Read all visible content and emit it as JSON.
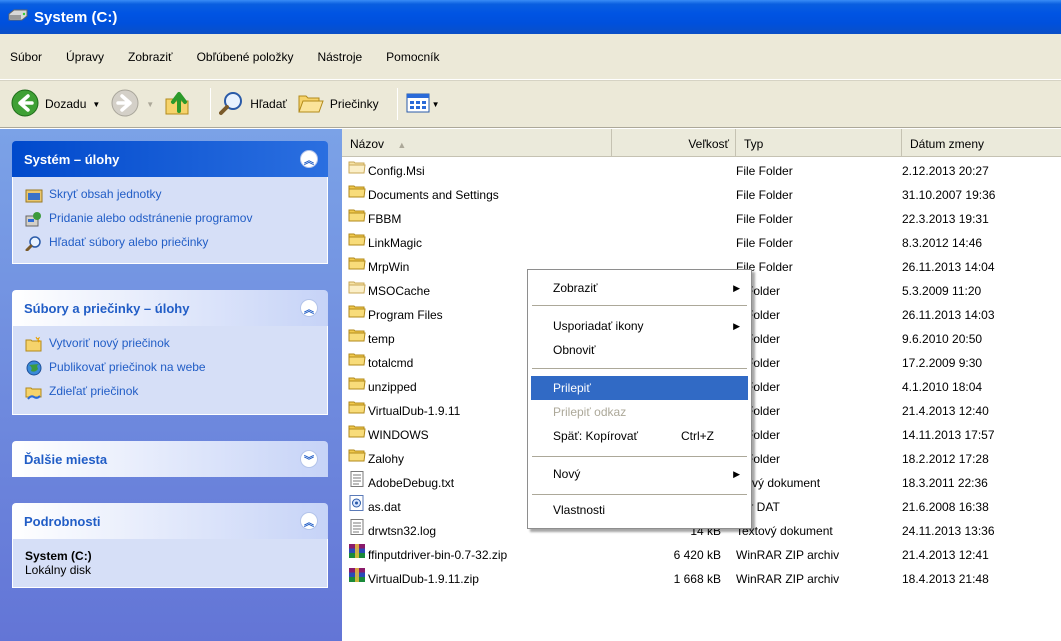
{
  "window": {
    "title": "System (C:)"
  },
  "menubar": [
    "Súbor",
    "Úpravy",
    "Zobraziť",
    "Obľúbené položky",
    "Nástroje",
    "Pomocník"
  ],
  "toolbar": {
    "back": "Dozadu",
    "search": "Hľadať",
    "folders": "Priečinky"
  },
  "tasks": {
    "system": {
      "title": "Systém – úlohy",
      "items": [
        "Skryť obsah jednotky",
        "Pridanie alebo odstránenie programov",
        "Hľadať súbory alebo priečinky"
      ]
    },
    "files": {
      "title": "Súbory a priečinky – úlohy",
      "items": [
        "Vytvoriť nový priečinok",
        "Publikovať priečinok na webe",
        "Zdieľať priečinok"
      ]
    },
    "other": {
      "title": "Ďalšie miesta"
    },
    "details": {
      "title": "Podrobnosti",
      "name": "System (C:)",
      "type": "Lokálny disk"
    }
  },
  "columns": {
    "name": "Názov",
    "size": "Veľkosť",
    "type": "Typ",
    "date": "Dátum zmeny"
  },
  "files": [
    {
      "name": "Config.Msi",
      "size": "",
      "type": "File Folder",
      "date": "2.12.2013 20:27",
      "icon": "folder-light"
    },
    {
      "name": "Documents and Settings",
      "size": "",
      "type": "File Folder",
      "date": "31.10.2007 19:36",
      "icon": "folder"
    },
    {
      "name": "FBBM",
      "size": "",
      "type": "File Folder",
      "date": "22.3.2013 19:31",
      "icon": "folder"
    },
    {
      "name": "LinkMagic",
      "size": "",
      "type": "File Folder",
      "date": "8.3.2012 14:46",
      "icon": "folder"
    },
    {
      "name": "MrpWin",
      "size": "",
      "type": "File Folder",
      "date": "26.11.2013 14:04",
      "icon": "folder"
    },
    {
      "name": "MSOCache",
      "size": "",
      "type": "e Folder",
      "date": "5.3.2009 11:20",
      "icon": "folder-light"
    },
    {
      "name": "Program Files",
      "size": "",
      "type": "e Folder",
      "date": "26.11.2013 14:03",
      "icon": "folder"
    },
    {
      "name": "temp",
      "size": "",
      "type": "e Folder",
      "date": "9.6.2010 20:50",
      "icon": "folder"
    },
    {
      "name": "totalcmd",
      "size": "",
      "type": "e Folder",
      "date": "17.2.2009 9:30",
      "icon": "folder"
    },
    {
      "name": "unzipped",
      "size": "",
      "type": "e Folder",
      "date": "4.1.2010 18:04",
      "icon": "folder"
    },
    {
      "name": "VirtualDub-1.9.11",
      "size": "",
      "type": "e Folder",
      "date": "21.4.2013 12:40",
      "icon": "folder"
    },
    {
      "name": "WINDOWS",
      "size": "",
      "type": "e Folder",
      "date": "14.11.2013 17:57",
      "icon": "folder"
    },
    {
      "name": "Zalohy",
      "size": "",
      "type": "e Folder",
      "date": "18.2.2012 17:28",
      "icon": "folder"
    },
    {
      "name": "AdobeDebug.txt",
      "size": "",
      "type": "xtový dokument",
      "date": "18.3.2011 22:36",
      "icon": "txt"
    },
    {
      "name": "as.dat",
      "size": "",
      "type": "bor DAT",
      "date": "21.6.2008 16:38",
      "icon": "dat"
    },
    {
      "name": "drwtsn32.log",
      "size": "14 kB",
      "type": "Textový dokument",
      "date": "24.11.2013 13:36",
      "icon": "txt"
    },
    {
      "name": "ffinputdriver-bin-0.7-32.zip",
      "size": "6 420 kB",
      "type": "WinRAR ZIP archiv",
      "date": "21.4.2013 12:41",
      "icon": "zip"
    },
    {
      "name": "VirtualDub-1.9.11.zip",
      "size": "1 668 kB",
      "type": "WinRAR ZIP archiv",
      "date": "18.4.2013 21:48",
      "icon": "zip"
    }
  ],
  "context_menu": {
    "view": "Zobraziť",
    "arrange": "Usporiadať ikony",
    "refresh": "Obnoviť",
    "paste": "Prilepiť",
    "paste_shortcut": "Prilepiť odkaz",
    "undo_copy": "Späť: Kopírovať",
    "undo_shortcut": "Ctrl+Z",
    "new": "Nový",
    "properties": "Vlastnosti"
  }
}
